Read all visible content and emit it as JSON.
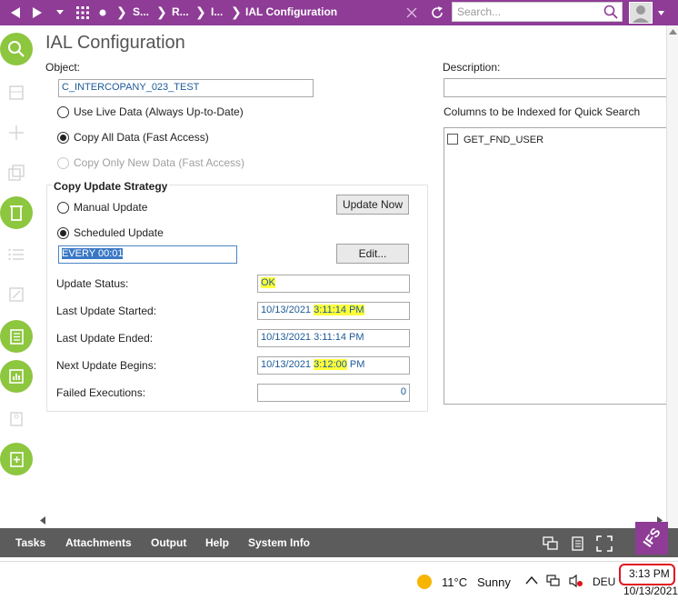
{
  "topbar": {
    "breadcrumbs": [
      "S...",
      "R...",
      "I...",
      "IAL Configuration"
    ],
    "search_placeholder": "Search..."
  },
  "page": {
    "title": "IAL Configuration"
  },
  "object": {
    "label": "Object:",
    "value": "C_INTERCOPANY_023_TEST"
  },
  "description": {
    "label": "Description:",
    "value": ""
  },
  "data_mode": {
    "options": [
      {
        "label": "Use Live Data (Always Up-to-Date)",
        "checked": false
      },
      {
        "label": "Copy All Data (Fast Access)",
        "checked": true
      },
      {
        "label": "Copy Only New Data (Fast Access)",
        "checked": false,
        "disabled": true
      }
    ]
  },
  "quick_search": {
    "label": "Columns to be Indexed for Quick Search",
    "items": [
      {
        "label": "GET_FND_USER",
        "checked": false
      }
    ]
  },
  "strategy": {
    "title": "Copy Update Strategy",
    "manual_label": "Manual Update",
    "scheduled_label": "Scheduled Update",
    "schedule_value": "EVERY 00:01",
    "update_now_label": "Update Now",
    "edit_label": "Edit..."
  },
  "status": {
    "update_status_label": "Update Status:",
    "update_status_value": "OK",
    "last_started_label": "Last Update Started:",
    "last_started_date": "10/13/2021",
    "last_started_time": "3:11:14 PM",
    "last_ended_label": "Last Update Ended:",
    "last_ended_value": "10/13/2021 3:11:14 PM",
    "next_begins_label": "Next Update Begins:",
    "next_begins_date": "10/13/2021",
    "next_begins_time_hl": "3:12:00",
    "next_begins_suffix": "PM",
    "failed_label": "Failed Executions:",
    "failed_value": "0"
  },
  "bottombar": {
    "items": [
      "Tasks",
      "Attachments",
      "Output",
      "Help",
      "System Info"
    ],
    "brand": "IFS"
  },
  "taskbar": {
    "temperature": "11°C",
    "weather": "Sunny",
    "language": "DEU",
    "time": "3:13 PM",
    "date": "10/13/2021"
  },
  "colors": {
    "header": "#8e3c96",
    "rail_green": "#8dc63f",
    "highlight": "#ffff3a",
    "bottom_bar": "#5c5c5c",
    "field_text": "#1c5a97",
    "clock_circle": "#e0141e"
  }
}
